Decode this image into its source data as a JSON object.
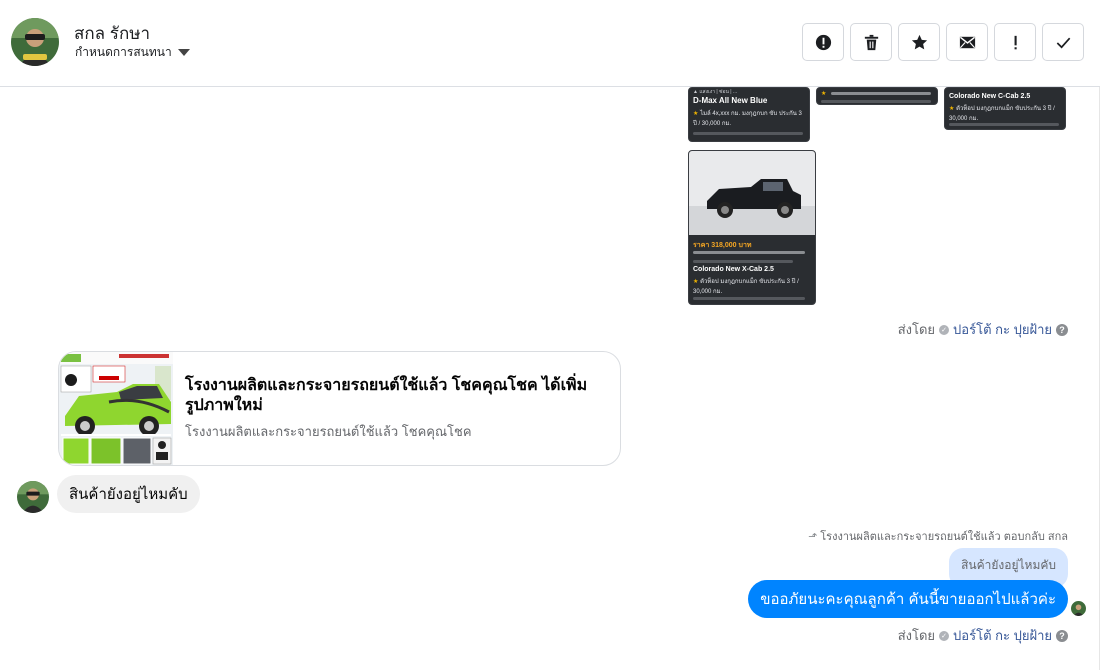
{
  "header": {
    "contact_name": "สกล รักษา",
    "conversation_label": "กำหนดการสนทนา",
    "actions": [
      {
        "name": "report-button",
        "icon": "exclamation-circle-icon"
      },
      {
        "name": "delete-button",
        "icon": "trash-icon"
      },
      {
        "name": "star-button",
        "icon": "star-icon"
      },
      {
        "name": "mark-unread-button",
        "icon": "envelope-icon"
      },
      {
        "name": "important-button",
        "icon": "exclamation-icon"
      },
      {
        "name": "done-button",
        "icon": "check-icon"
      }
    ]
  },
  "thumbnails": {
    "t1": {
      "title": "D-Max All New Blue",
      "line": "ไมล์ 4x,xxx กม. มงกุฎกบก ขับ ประกัน 3 ปี / 30,000 กม."
    },
    "t3": {
      "title": "Colorado New C-Cab 2.5",
      "line": "ตัวท็อป มงกุฎกบกแม็ก ขับประกัน 3 ปี / 30,000 กม."
    },
    "t4": {
      "price": "ราคา 318,000 บาท",
      "title": "Colorado New X-Cab 2.5",
      "line": "ตัวท็อป มงกุฎกบกแม็ก ขับประกัน 3 ปี / 30,000 กม."
    }
  },
  "sent_by_1": {
    "prefix": "ส่งโดย",
    "name": "ปอร์โต้ กะ ปุยฝ้าย",
    "help": "?"
  },
  "link_card": {
    "title": "โรงงานผลิตและกระจายรถยนต์ใช้แล้ว โชคคุณโชค ได้เพิ่มรูปภาพใหม่",
    "subtitle": "โรงงานผลิตและกระจายรถยนต์ใช้แล้ว โชคคุณโชค"
  },
  "incoming_message": "สินค้ายังอยู่ไหมคับ",
  "reply_note": "โรงงานผลิตและกระจายรถยนต์ใช้แล้ว ตอบกลับ สกล",
  "quoted_message": "สินค้ายังอยู่ไหมคับ",
  "outgoing_message": "ขออภัยนะคะคุณลูกค้า คันนี้ขายออกไปแล้วค่ะ",
  "sent_by_2": {
    "prefix": "ส่งโดย",
    "name": "ปอร์โต้ กะ ปุยฝ้าย",
    "help": "?"
  }
}
